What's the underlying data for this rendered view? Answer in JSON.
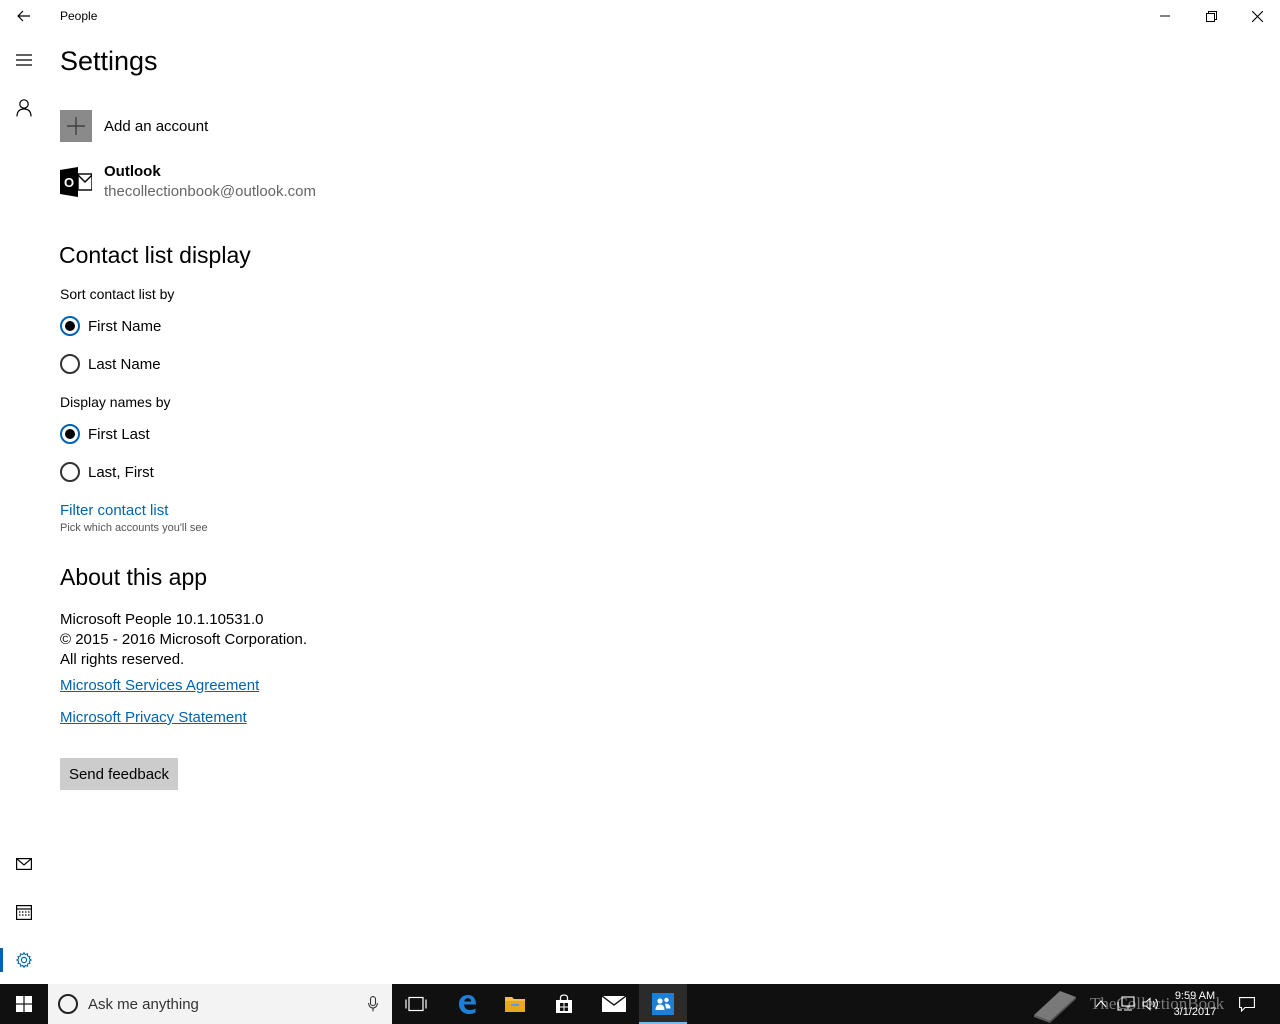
{
  "window": {
    "app_title": "People",
    "controls": {
      "minimize": "minimize",
      "maximize": "restore",
      "close": "close"
    }
  },
  "rail": {
    "items": [
      "hamburger-menu",
      "contacts",
      "mail",
      "calendar",
      "settings"
    ],
    "selected": "settings",
    "accent": "#0063b1"
  },
  "settings": {
    "title": "Settings",
    "add_account": "Add an account",
    "account": {
      "name": "Outlook",
      "email": "thecollectionbook@outlook.com",
      "tile_letter": "O"
    },
    "contact_list": {
      "title": "Contact list display",
      "sort_label": "Sort contact list by",
      "sort_options": [
        {
          "label": "First Name",
          "checked": true
        },
        {
          "label": "Last Name",
          "checked": false
        }
      ],
      "display_label": "Display names by",
      "display_options": [
        {
          "label": "First Last",
          "checked": true
        },
        {
          "label": "Last, First",
          "checked": false
        }
      ],
      "filter_link": "Filter contact list",
      "filter_hint": "Pick which accounts you'll see"
    },
    "about": {
      "title": "About this app",
      "version": "Microsoft People 10.1.10531.0",
      "copyright": "© 2015 - 2016 Microsoft Corporation.",
      "rights": "All rights reserved.",
      "services_link": "Microsoft Services Agreement",
      "privacy_link": "Microsoft Privacy Statement",
      "feedback_button": "Send feedback"
    }
  },
  "taskbar": {
    "search_placeholder": "Ask me anything",
    "apps": [
      "task-view",
      "edge",
      "file-explorer",
      "store",
      "mail",
      "people"
    ],
    "active_app": "people",
    "watermark": "TheCollectionBook",
    "clock": {
      "time": "9:59 AM",
      "date": "3/1/2017"
    }
  }
}
